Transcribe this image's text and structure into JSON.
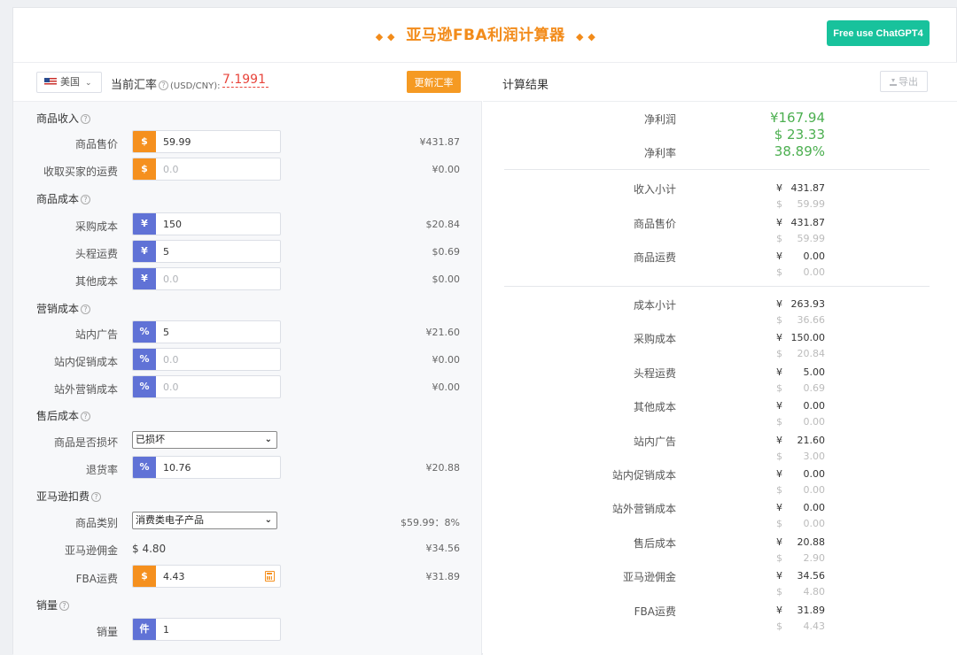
{
  "header": {
    "title": "亚马逊FBA利润计算器",
    "diamonds": "◆ ◆",
    "gpt_button": "Free use ChatGPT4"
  },
  "toolbar": {
    "country": "美国",
    "rate_label": "当前汇率",
    "rate_unit": "(USD/CNY):",
    "rate_value": "7.1991",
    "update_button": "更新汇率"
  },
  "form": {
    "income": {
      "title": "商品收入",
      "price": {
        "label": "商品售价",
        "prefix": "$",
        "value": "59.99",
        "converted": "¥431.87"
      },
      "buyer_shipping": {
        "label": "收取买家的运费",
        "prefix": "$",
        "placeholder": "0.0",
        "converted": "¥0.00"
      }
    },
    "cost": {
      "title": "商品成本",
      "purchase": {
        "label": "采购成本",
        "prefix": "¥",
        "value": "150",
        "converted": "$20.84"
      },
      "first_leg": {
        "label": "头程运费",
        "prefix": "¥",
        "value": "5",
        "converted": "$0.69"
      },
      "other": {
        "label": "其他成本",
        "prefix": "¥",
        "placeholder": "0.0",
        "converted": "$0.00"
      }
    },
    "marketing": {
      "title": "营销成本",
      "ads": {
        "label": "站内广告",
        "prefix": "%",
        "value": "5",
        "converted": "¥21.60"
      },
      "promo": {
        "label": "站内促销成本",
        "prefix": "%",
        "placeholder": "0.0",
        "converted": "¥0.00"
      },
      "offsite": {
        "label": "站外营销成本",
        "prefix": "%",
        "placeholder": "0.0",
        "converted": "¥0.00"
      }
    },
    "after_sales": {
      "title": "售后成本",
      "damaged": {
        "label": "商品是否损坏",
        "selected": "已损坏"
      },
      "return_rate": {
        "label": "退货率",
        "prefix": "%",
        "value": "10.76",
        "converted": "¥20.88"
      }
    },
    "amazon_fees": {
      "title": "亚马逊扣费",
      "category": {
        "label": "商品类别",
        "selected": "消费类电子产品",
        "info": "$59.99：8%"
      },
      "commission": {
        "label": "亚马逊佣金",
        "value": "$ 4.80",
        "converted": "¥34.56"
      },
      "fba": {
        "label": "FBA运费",
        "prefix": "$",
        "value": "4.43",
        "converted": "¥31.89"
      }
    },
    "quantity": {
      "title": "销量",
      "qty": {
        "label": "销量",
        "prefix": "件",
        "value": "1"
      }
    }
  },
  "results": {
    "title": "计算结果",
    "export_button": "导出",
    "net_profit": {
      "label": "净利润",
      "cny": "¥167.94",
      "usd": "$ 23.33"
    },
    "margin": {
      "label": "净利率",
      "value": "38.89%"
    },
    "rows": [
      {
        "label": "收入小计",
        "cny": "431.87",
        "usd": "59.99"
      },
      {
        "label": "商品售价",
        "cny": "431.87",
        "usd": "59.99"
      },
      {
        "label": "商品运费",
        "cny": "0.00",
        "usd": "0.00"
      },
      {
        "label": "成本小计",
        "cny": "263.93",
        "usd": "36.66"
      },
      {
        "label": "采购成本",
        "cny": "150.00",
        "usd": "20.84"
      },
      {
        "label": "头程运费",
        "cny": "5.00",
        "usd": "0.69"
      },
      {
        "label": "其他成本",
        "cny": "0.00",
        "usd": "0.00"
      },
      {
        "label": "站内广告",
        "cny": "21.60",
        "usd": "3.00"
      },
      {
        "label": "站内促销成本",
        "cny": "0.00",
        "usd": "0.00"
      },
      {
        "label": "站外营销成本",
        "cny": "0.00",
        "usd": "0.00"
      },
      {
        "label": "售后成本",
        "cny": "20.88",
        "usd": "2.90"
      },
      {
        "label": "亚马逊佣金",
        "cny": "34.56",
        "usd": "4.80"
      },
      {
        "label": "FBA运费",
        "cny": "31.89",
        "usd": "4.43"
      }
    ],
    "cny_symbol": "¥",
    "usd_symbol": "$"
  },
  "colors": {
    "accent": "#f28b1a",
    "profit": "#4caf50",
    "gpt": "#18c29c",
    "rate": "#e8453c",
    "prefix_orange": "#f5901e",
    "prefix_blue": "#6072d6"
  }
}
